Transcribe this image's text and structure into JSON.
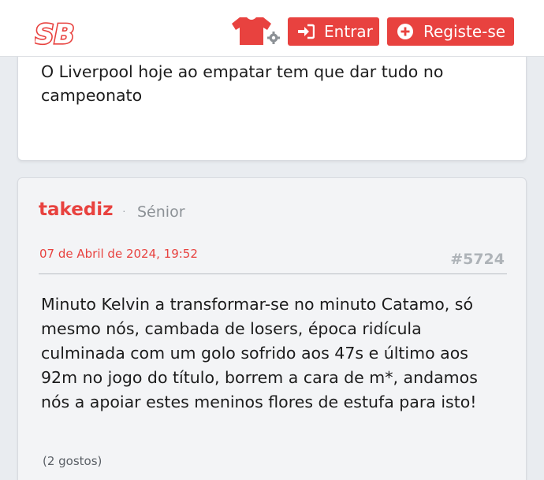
{
  "header": {
    "logo_text": "SB",
    "login_label": "Entrar",
    "register_label": "Registe-se",
    "icons": [
      "shirt-icon",
      "gear-icon",
      "login-arrow-icon",
      "plus-circle-icon"
    ],
    "accent_color": "#e8423f"
  },
  "previous_post": {
    "text": "O Liverpool hoje ao empatar tem que dar tudo no campeonato"
  },
  "post": {
    "username": "takediz",
    "separator": "·",
    "rank": "Sénior",
    "date": "07 de Abril de 2024, 19:52",
    "number": "#5724",
    "body": "Minuto Kelvin a transformar-se no minuto Catamo, só mesmo nós, cambada de losers, época ridícula culminada com um golo sofrido aos 47s e último aos 92m no jogo do título, borrem a cara de m*, andamos nós a apoiar estes meninos flores de estufa para isto!",
    "likes": "(2 gostos)"
  }
}
